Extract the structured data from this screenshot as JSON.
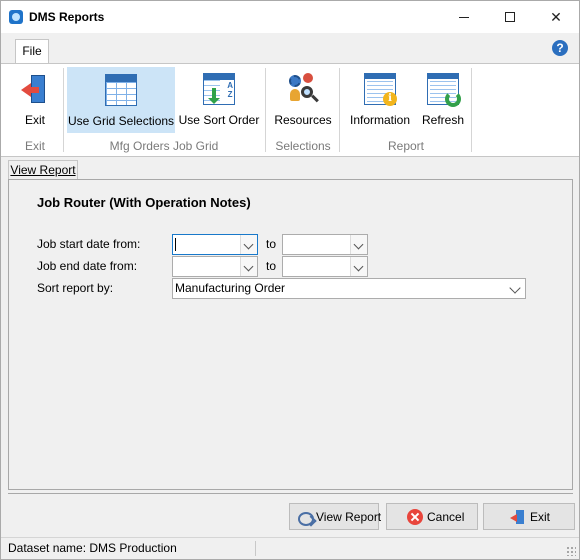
{
  "window": {
    "title": "DMS Reports"
  },
  "ribbon": {
    "file_tab": "File",
    "buttons": {
      "exit": "Exit",
      "use_grid": "Use Grid Selections",
      "use_sort": "Use Sort Order",
      "resources": "Resources",
      "information": "Information",
      "refresh": "Refresh"
    },
    "groups": {
      "exit": "Exit",
      "mfg": "Mfg Orders Job Grid",
      "selections": "Selections",
      "report": "Report"
    }
  },
  "content": {
    "tab": "View Report",
    "report_title": "Job Router (With Operation Notes)",
    "fields": {
      "start_label": "Job start date from:",
      "end_label": "Job end date from:",
      "sort_label": "Sort report by:",
      "to": "to",
      "start_from": "",
      "start_to": "",
      "end_from": "",
      "end_to": "",
      "sort_value": "Manufacturing Order"
    }
  },
  "actions": {
    "view_report": "View Report",
    "cancel": "Cancel",
    "exit": "Exit"
  },
  "status": {
    "dataset": "Dataset name:  DMS Production"
  },
  "colors": {
    "accent": "#1979ca",
    "active_bg": "#cce4f7",
    "close": "#e8453c"
  }
}
